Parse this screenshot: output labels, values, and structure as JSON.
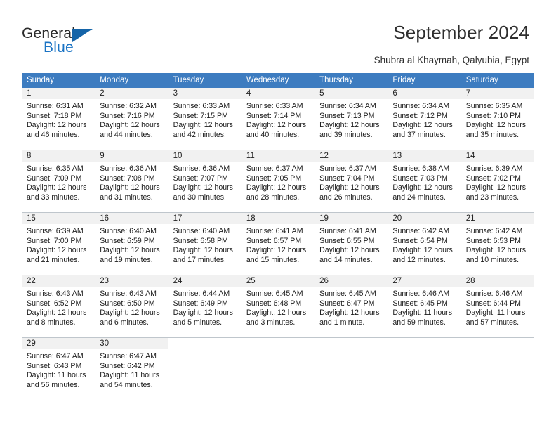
{
  "brand": {
    "name_part1": "General",
    "name_part2": "Blue",
    "triangle_color": "#1464a8",
    "blue_color": "#1a73c4"
  },
  "header": {
    "title": "September 2024",
    "location": "Shubra al Khaymah, Qalyubia, Egypt"
  },
  "calendar": {
    "header_bg": "#3d7cc0",
    "date_strip_bg": "#f1f1f1",
    "weekday_headers": [
      "Sunday",
      "Monday",
      "Tuesday",
      "Wednesday",
      "Thursday",
      "Friday",
      "Saturday"
    ],
    "weeks": [
      [
        {
          "date": "1",
          "sunrise": "Sunrise: 6:31 AM",
          "sunset": "Sunset: 7:18 PM",
          "daylight_line1": "Daylight: 12 hours",
          "daylight_line2": "and 46 minutes."
        },
        {
          "date": "2",
          "sunrise": "Sunrise: 6:32 AM",
          "sunset": "Sunset: 7:16 PM",
          "daylight_line1": "Daylight: 12 hours",
          "daylight_line2": "and 44 minutes."
        },
        {
          "date": "3",
          "sunrise": "Sunrise: 6:33 AM",
          "sunset": "Sunset: 7:15 PM",
          "daylight_line1": "Daylight: 12 hours",
          "daylight_line2": "and 42 minutes."
        },
        {
          "date": "4",
          "sunrise": "Sunrise: 6:33 AM",
          "sunset": "Sunset: 7:14 PM",
          "daylight_line1": "Daylight: 12 hours",
          "daylight_line2": "and 40 minutes."
        },
        {
          "date": "5",
          "sunrise": "Sunrise: 6:34 AM",
          "sunset": "Sunset: 7:13 PM",
          "daylight_line1": "Daylight: 12 hours",
          "daylight_line2": "and 39 minutes."
        },
        {
          "date": "6",
          "sunrise": "Sunrise: 6:34 AM",
          "sunset": "Sunset: 7:12 PM",
          "daylight_line1": "Daylight: 12 hours",
          "daylight_line2": "and 37 minutes."
        },
        {
          "date": "7",
          "sunrise": "Sunrise: 6:35 AM",
          "sunset": "Sunset: 7:10 PM",
          "daylight_line1": "Daylight: 12 hours",
          "daylight_line2": "and 35 minutes."
        }
      ],
      [
        {
          "date": "8",
          "sunrise": "Sunrise: 6:35 AM",
          "sunset": "Sunset: 7:09 PM",
          "daylight_line1": "Daylight: 12 hours",
          "daylight_line2": "and 33 minutes."
        },
        {
          "date": "9",
          "sunrise": "Sunrise: 6:36 AM",
          "sunset": "Sunset: 7:08 PM",
          "daylight_line1": "Daylight: 12 hours",
          "daylight_line2": "and 31 minutes."
        },
        {
          "date": "10",
          "sunrise": "Sunrise: 6:36 AM",
          "sunset": "Sunset: 7:07 PM",
          "daylight_line1": "Daylight: 12 hours",
          "daylight_line2": "and 30 minutes."
        },
        {
          "date": "11",
          "sunrise": "Sunrise: 6:37 AM",
          "sunset": "Sunset: 7:05 PM",
          "daylight_line1": "Daylight: 12 hours",
          "daylight_line2": "and 28 minutes."
        },
        {
          "date": "12",
          "sunrise": "Sunrise: 6:37 AM",
          "sunset": "Sunset: 7:04 PM",
          "daylight_line1": "Daylight: 12 hours",
          "daylight_line2": "and 26 minutes."
        },
        {
          "date": "13",
          "sunrise": "Sunrise: 6:38 AM",
          "sunset": "Sunset: 7:03 PM",
          "daylight_line1": "Daylight: 12 hours",
          "daylight_line2": "and 24 minutes."
        },
        {
          "date": "14",
          "sunrise": "Sunrise: 6:39 AM",
          "sunset": "Sunset: 7:02 PM",
          "daylight_line1": "Daylight: 12 hours",
          "daylight_line2": "and 23 minutes."
        }
      ],
      [
        {
          "date": "15",
          "sunrise": "Sunrise: 6:39 AM",
          "sunset": "Sunset: 7:00 PM",
          "daylight_line1": "Daylight: 12 hours",
          "daylight_line2": "and 21 minutes."
        },
        {
          "date": "16",
          "sunrise": "Sunrise: 6:40 AM",
          "sunset": "Sunset: 6:59 PM",
          "daylight_line1": "Daylight: 12 hours",
          "daylight_line2": "and 19 minutes."
        },
        {
          "date": "17",
          "sunrise": "Sunrise: 6:40 AM",
          "sunset": "Sunset: 6:58 PM",
          "daylight_line1": "Daylight: 12 hours",
          "daylight_line2": "and 17 minutes."
        },
        {
          "date": "18",
          "sunrise": "Sunrise: 6:41 AM",
          "sunset": "Sunset: 6:57 PM",
          "daylight_line1": "Daylight: 12 hours",
          "daylight_line2": "and 15 minutes."
        },
        {
          "date": "19",
          "sunrise": "Sunrise: 6:41 AM",
          "sunset": "Sunset: 6:55 PM",
          "daylight_line1": "Daylight: 12 hours",
          "daylight_line2": "and 14 minutes."
        },
        {
          "date": "20",
          "sunrise": "Sunrise: 6:42 AM",
          "sunset": "Sunset: 6:54 PM",
          "daylight_line1": "Daylight: 12 hours",
          "daylight_line2": "and 12 minutes."
        },
        {
          "date": "21",
          "sunrise": "Sunrise: 6:42 AM",
          "sunset": "Sunset: 6:53 PM",
          "daylight_line1": "Daylight: 12 hours",
          "daylight_line2": "and 10 minutes."
        }
      ],
      [
        {
          "date": "22",
          "sunrise": "Sunrise: 6:43 AM",
          "sunset": "Sunset: 6:52 PM",
          "daylight_line1": "Daylight: 12 hours",
          "daylight_line2": "and 8 minutes."
        },
        {
          "date": "23",
          "sunrise": "Sunrise: 6:43 AM",
          "sunset": "Sunset: 6:50 PM",
          "daylight_line1": "Daylight: 12 hours",
          "daylight_line2": "and 6 minutes."
        },
        {
          "date": "24",
          "sunrise": "Sunrise: 6:44 AM",
          "sunset": "Sunset: 6:49 PM",
          "daylight_line1": "Daylight: 12 hours",
          "daylight_line2": "and 5 minutes."
        },
        {
          "date": "25",
          "sunrise": "Sunrise: 6:45 AM",
          "sunset": "Sunset: 6:48 PM",
          "daylight_line1": "Daylight: 12 hours",
          "daylight_line2": "and 3 minutes."
        },
        {
          "date": "26",
          "sunrise": "Sunrise: 6:45 AM",
          "sunset": "Sunset: 6:47 PM",
          "daylight_line1": "Daylight: 12 hours",
          "daylight_line2": "and 1 minute."
        },
        {
          "date": "27",
          "sunrise": "Sunrise: 6:46 AM",
          "sunset": "Sunset: 6:45 PM",
          "daylight_line1": "Daylight: 11 hours",
          "daylight_line2": "and 59 minutes."
        },
        {
          "date": "28",
          "sunrise": "Sunrise: 6:46 AM",
          "sunset": "Sunset: 6:44 PM",
          "daylight_line1": "Daylight: 11 hours",
          "daylight_line2": "and 57 minutes."
        }
      ],
      [
        {
          "date": "29",
          "sunrise": "Sunrise: 6:47 AM",
          "sunset": "Sunset: 6:43 PM",
          "daylight_line1": "Daylight: 11 hours",
          "daylight_line2": "and 56 minutes."
        },
        {
          "date": "30",
          "sunrise": "Sunrise: 6:47 AM",
          "sunset": "Sunset: 6:42 PM",
          "daylight_line1": "Daylight: 11 hours",
          "daylight_line2": "and 54 minutes."
        },
        {
          "date": "",
          "sunrise": "",
          "sunset": "",
          "daylight_line1": "",
          "daylight_line2": ""
        },
        {
          "date": "",
          "sunrise": "",
          "sunset": "",
          "daylight_line1": "",
          "daylight_line2": ""
        },
        {
          "date": "",
          "sunrise": "",
          "sunset": "",
          "daylight_line1": "",
          "daylight_line2": ""
        },
        {
          "date": "",
          "sunrise": "",
          "sunset": "",
          "daylight_line1": "",
          "daylight_line2": ""
        },
        {
          "date": "",
          "sunrise": "",
          "sunset": "",
          "daylight_line1": "",
          "daylight_line2": ""
        }
      ]
    ]
  }
}
